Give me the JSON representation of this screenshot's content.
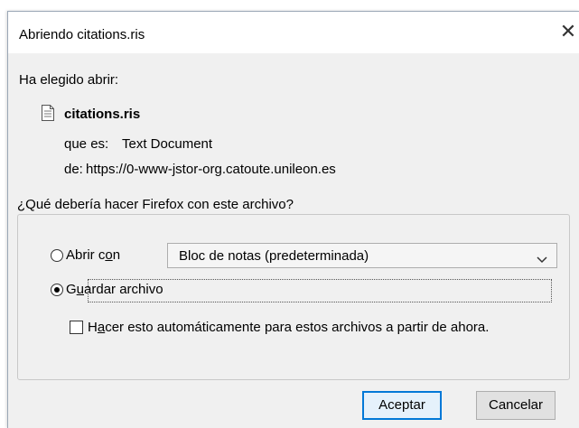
{
  "dialog": {
    "title": "Abriendo citations.ris",
    "close_glyph": "✕"
  },
  "info": {
    "intro": "Ha elegido abrir:",
    "filename": "citations.ris",
    "type_label": "que es:",
    "type_value": "Text Document",
    "from_label": "de:",
    "from_value": "https://0-www-jstor-org.catoute.unileon.es"
  },
  "action": {
    "legend": "¿Qué debería hacer Firefox con este archivo?",
    "open_with_pre": "Abrir c",
    "open_with_u": "o",
    "open_with_post": "n",
    "open_with_app": "Bloc de notas (predeterminada)",
    "save_pre": "G",
    "save_u": "u",
    "save_post": "ardar archivo",
    "save_selected": true,
    "auto_pre": "H",
    "auto_u": "a",
    "auto_post": "cer esto automáticamente para estos archivos a partir de ahora.",
    "auto_checked": false
  },
  "buttons": {
    "accept": "Aceptar",
    "cancel": "Cancelar"
  },
  "icons": {
    "file": "document-icon",
    "dropdown": "chevron-down-icon",
    "close": "close-icon"
  },
  "colors": {
    "accent": "#0078d7",
    "dialog_bg": "#f0f0f0"
  }
}
